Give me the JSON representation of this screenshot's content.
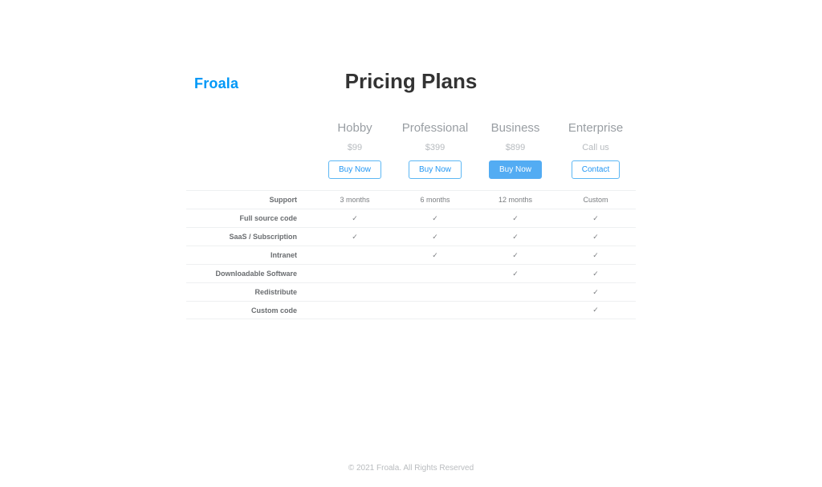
{
  "logo": "Froala",
  "title": "Pricing Plans",
  "plans": [
    {
      "name": "Hobby",
      "price": "$99",
      "cta": "Buy Now",
      "primary": false
    },
    {
      "name": "Professional",
      "price": "$399",
      "cta": "Buy Now",
      "primary": false
    },
    {
      "name": "Business",
      "price": "$899",
      "cta": "Buy Now",
      "primary": true
    },
    {
      "name": "Enterprise",
      "price": "Call us",
      "cta": "Contact",
      "primary": false
    }
  ],
  "features": [
    {
      "label": "Support",
      "values": [
        "3 months",
        "6 months",
        "12 months",
        "Custom"
      ]
    },
    {
      "label": "Full source code",
      "values": [
        "✓",
        "✓",
        "✓",
        "✓"
      ]
    },
    {
      "label": "SaaS / Subscription",
      "values": [
        "✓",
        "✓",
        "✓",
        "✓"
      ]
    },
    {
      "label": "Intranet",
      "values": [
        "",
        "✓",
        "✓",
        "✓"
      ]
    },
    {
      "label": "Downloadable Software",
      "values": [
        "",
        "",
        "✓",
        "✓"
      ]
    },
    {
      "label": "Redistribute",
      "values": [
        "",
        "",
        "",
        "✓"
      ]
    },
    {
      "label": "Custom code",
      "values": [
        "",
        "",
        "",
        "✓"
      ]
    }
  ],
  "footer": "© 2021 Froala. All Rights Reserved"
}
